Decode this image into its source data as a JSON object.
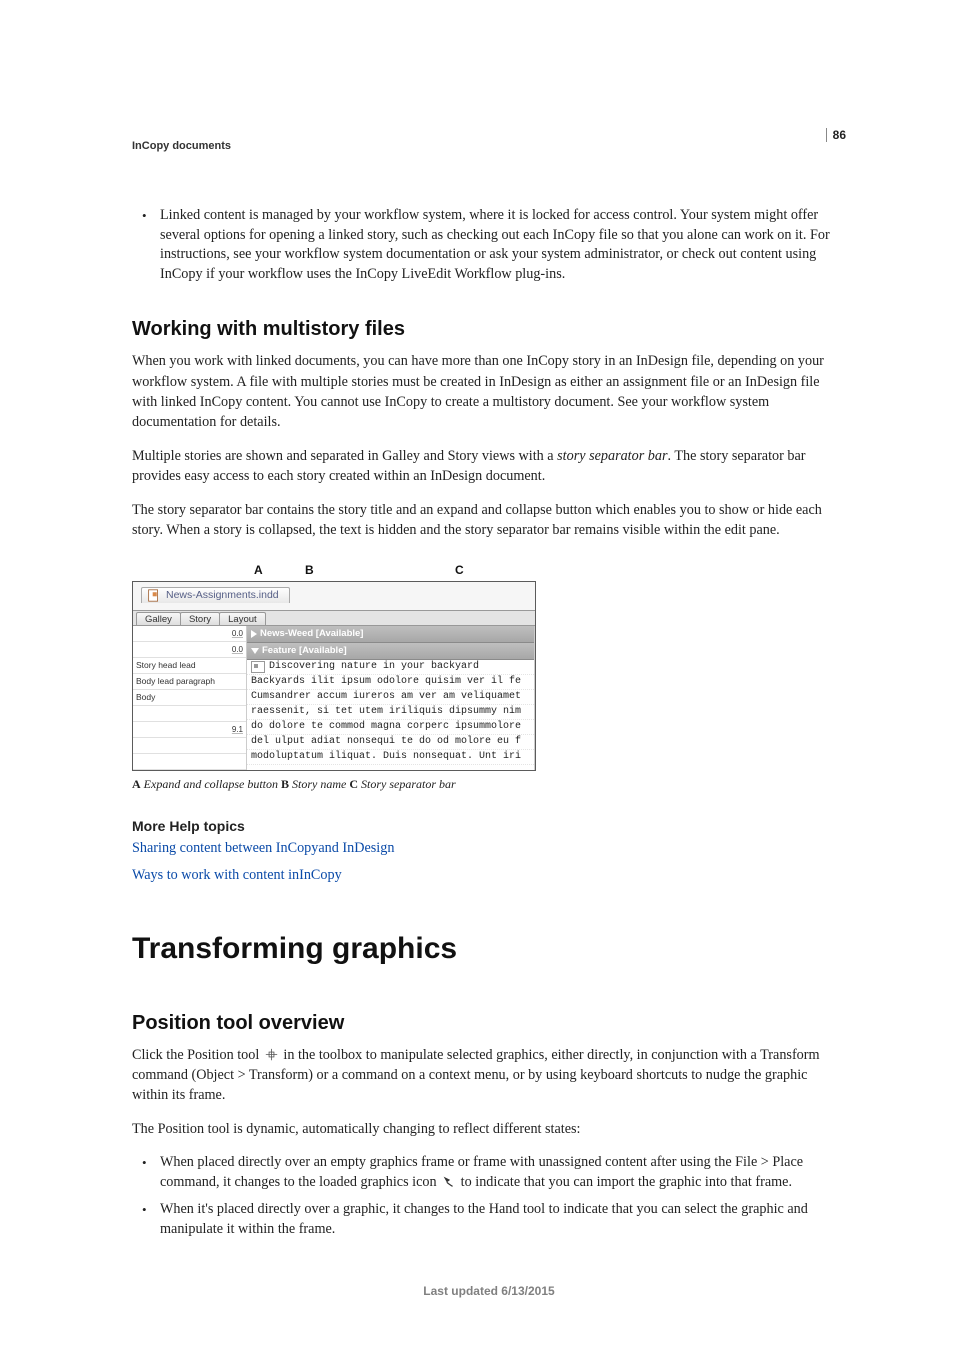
{
  "page_number": "86",
  "running_head": "InCopy documents",
  "top_bullet": "Linked content is managed by your workflow system, where it is locked for access control. Your system might offer several options for opening a linked story, such as checking out each InCopy file so that you alone can work on it. For instructions, see your workflow system documentation or ask your system administrator, or check out content using InCopy if your workflow uses the InCopy LiveEdit Workflow plug-ins.",
  "section1": {
    "title": "Working with multistory files",
    "p1": "When you work with linked documents, you can have more than one InCopy story in an InDesign file, depending on your workflow system. A file with multiple stories must be created in InDesign as either an assignment file or an InDesign file with linked InCopy content. You cannot use InCopy to create a multistory document. See your workflow system documentation for details.",
    "p2a": "Multiple stories are shown and separated in Galley and Story views with a ",
    "p2_em": "story separator bar",
    "p2b": ". The story separator bar provides easy access to each story created within an InDesign document.",
    "p3": "The story separator bar contains the story title and an expand and collapse button which enables you to show or hide each story. When a story is collapsed, the text is hidden and the story separator bar remains visible within the edit pane."
  },
  "figure": {
    "callouts": {
      "a": "A",
      "b": "B",
      "c": "C"
    },
    "doc_tab": "News-Assignments.indd",
    "tabs": [
      "Galley",
      "Story",
      "Layout"
    ],
    "left_rows": [
      {
        "label": "",
        "value": "0.0"
      },
      {
        "label": "",
        "value": "0.0"
      },
      {
        "label": "Story head lead",
        "value": ""
      },
      {
        "label": "Body lead paragraph",
        "value": ""
      },
      {
        "label": "Body",
        "value": ""
      },
      {
        "label": "",
        "value": ""
      },
      {
        "label": "",
        "value": "9.1"
      },
      {
        "label": "",
        "value": ""
      },
      {
        "label": "",
        "value": ""
      }
    ],
    "story_bars": [
      {
        "icon": "tri-right",
        "label": "News-Weed [Available]"
      },
      {
        "icon": "tri-down",
        "label": "Feature [Available]"
      }
    ],
    "text_lines": [
      "Discovering nature in your backyard",
      "Backyards ilit ipsum odolore quisim ver il fe",
      "Cumsandrer accum iureros am ver am veliquamet",
      "raessenit, si tet utem iriliquis dipsummy nim",
      "do dolore te commod magna corperc ipsummolore",
      "del ulput adiat nonsequi te do od molore eu f",
      "modoluptatum iliquat. Duis nonsequat. Unt iri"
    ],
    "caption": {
      "a_bold": "A",
      "a_txt": " Expand and collapse button  ",
      "b_bold": "B",
      "b_txt": " Story name  ",
      "c_bold": "C",
      "c_txt": " Story separator bar"
    }
  },
  "more_help": {
    "title": "More Help topics",
    "links": [
      "Sharing content between InCopyand InDesign",
      "Ways to work with content inInCopy"
    ]
  },
  "chapter2": "Transforming graphics",
  "section2": {
    "title": "Position tool overview",
    "p1a": "Click the Position tool ",
    "p1b": " in the toolbox to manipulate selected graphics, either directly, in conjunction with a Transform command (Object > Transform) or a command on a context menu, or by using keyboard shortcuts to nudge the graphic within its frame.",
    "p2": "The Position tool is dynamic, automatically changing to reflect different states:",
    "b1a": "When placed directly over an empty graphics frame or frame with unassigned content after using the File > Place command, it changes to the loaded graphics icon ",
    "b1b": " to indicate that you can import the graphic into that frame.",
    "b2": "When it's placed directly over a graphic, it changes to the Hand tool to indicate that you can select the graphic and manipulate it within the frame."
  },
  "footer": "Last updated 6/13/2015"
}
